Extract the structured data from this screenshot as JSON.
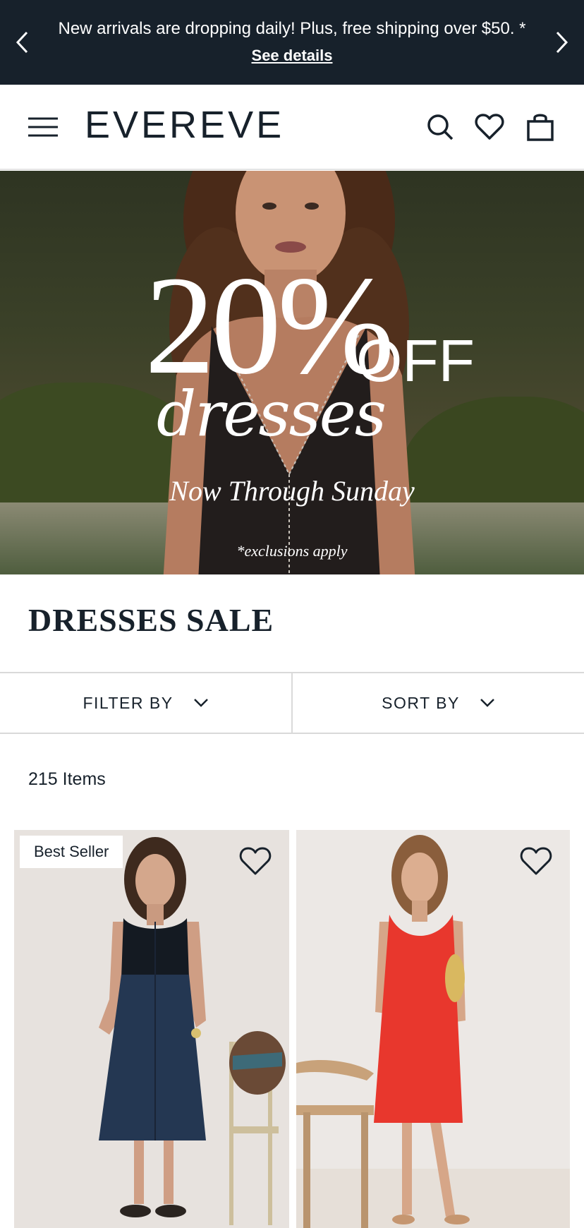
{
  "announcement": {
    "message": "New arrivals are dropping daily! Plus, free shipping over $50. *",
    "link_label": "See details"
  },
  "header": {
    "logo": "EVEREVE",
    "icons": [
      "menu-icon",
      "search-icon",
      "heart-icon",
      "bag-icon"
    ]
  },
  "hero": {
    "percent": "20%",
    "off": "OFF",
    "script": "dresses",
    "subtitle": "Now Through Sunday",
    "note": "*exclusions apply"
  },
  "page": {
    "title": "DRESSES SALE",
    "item_count": "215 Items"
  },
  "toolbar": {
    "filter_label": "FILTER BY",
    "sort_label": "SORT BY"
  },
  "products": [
    {
      "badge": "Best Seller",
      "image": "navy-black-tiered-midi-dress"
    },
    {
      "badge": "",
      "image": "red-sleeveless-mini-dress"
    }
  ],
  "colors": {
    "dark": "#17212b",
    "accent_red": "#e8372d",
    "navy_dress": "#243752"
  }
}
